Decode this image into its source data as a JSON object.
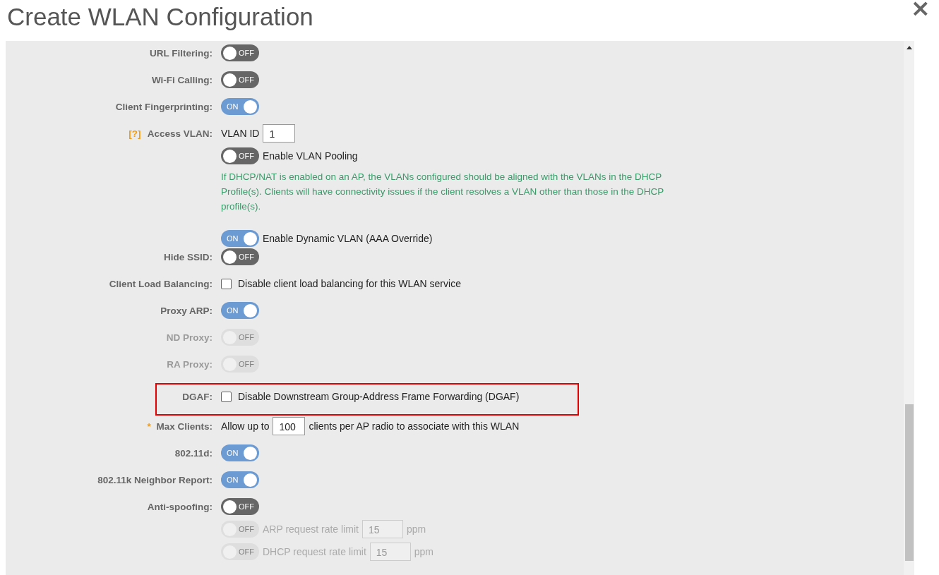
{
  "dialog": {
    "title": "Create WLAN Configuration",
    "close": "×"
  },
  "rows": [
    {
      "label": "URL Filtering:",
      "disabled": false,
      "highlighted": false,
      "lines": [
        [
          {
            "kind": "toggle",
            "on": false,
            "text": "OFF",
            "disabled": false
          }
        ]
      ]
    },
    {
      "label": "Wi-Fi Calling:",
      "disabled": false,
      "highlighted": false,
      "lines": [
        [
          {
            "kind": "toggle",
            "on": false,
            "text": "OFF",
            "disabled": false
          }
        ]
      ]
    },
    {
      "label": "Client Fingerprinting:",
      "disabled": false,
      "highlighted": false,
      "lines": [
        [
          {
            "kind": "toggle",
            "on": true,
            "text": "ON",
            "disabled": false
          }
        ]
      ]
    },
    {
      "help": "[?]",
      "label": "Access VLAN:",
      "disabled": false,
      "highlighted": false,
      "lines": [
        [
          {
            "kind": "text",
            "text": "VLAN ID",
            "disabled": false
          },
          {
            "kind": "field",
            "value": "1",
            "disabled": false
          }
        ],
        [
          {
            "kind": "toggle",
            "on": false,
            "text": "OFF",
            "disabled": false
          },
          {
            "kind": "text",
            "text": "Enable VLAN Pooling",
            "disabled": false
          }
        ],
        [
          {
            "kind": "note",
            "text": "If DHCP/NAT is enabled on an AP, the VLANs configured should be aligned with the VLANs in the DHCP Profile(s). Clients will have connectivity issues if the client resolves a VLAN other than those in the DHCP profile(s)."
          }
        ],
        [
          {
            "kind": "toggle",
            "on": true,
            "text": "ON",
            "disabled": false
          },
          {
            "kind": "text",
            "text": "Enable Dynamic VLAN (AAA Override)",
            "disabled": false
          }
        ]
      ]
    },
    {
      "label": "Hide SSID:",
      "disabled": false,
      "highlighted": false,
      "lines": [
        [
          {
            "kind": "toggle",
            "on": false,
            "text": "OFF",
            "disabled": false
          }
        ]
      ]
    },
    {
      "label": "Client Load Balancing:",
      "disabled": false,
      "highlighted": false,
      "lines": [
        [
          {
            "kind": "checkbox",
            "checked": false,
            "label": "Disable client load balancing for this WLAN service"
          }
        ]
      ]
    },
    {
      "label": "Proxy ARP:",
      "disabled": false,
      "highlighted": false,
      "lines": [
        [
          {
            "kind": "toggle",
            "on": true,
            "text": "ON",
            "disabled": false
          }
        ]
      ]
    },
    {
      "label": "ND Proxy:",
      "disabled": true,
      "highlighted": false,
      "lines": [
        [
          {
            "kind": "toggle",
            "on": false,
            "text": "OFF",
            "disabled": true
          }
        ]
      ]
    },
    {
      "label": "RA Proxy:",
      "disabled": true,
      "highlighted": false,
      "lines": [
        [
          {
            "kind": "toggle",
            "on": false,
            "text": "OFF",
            "disabled": true
          }
        ]
      ]
    },
    {
      "label": "DGAF:",
      "disabled": false,
      "highlighted": true,
      "lines": [
        [
          {
            "kind": "checkbox",
            "checked": false,
            "label": "Disable Downstream Group-Address Frame Forwarding (DGAF)"
          }
        ]
      ]
    },
    {
      "required": "*",
      "label": "Max Clients:",
      "disabled": false,
      "highlighted": false,
      "lines": [
        [
          {
            "kind": "text",
            "text": "Allow up to",
            "disabled": false
          },
          {
            "kind": "field",
            "value": "100",
            "disabled": false
          },
          {
            "kind": "text",
            "text": "clients per AP radio to associate with this WLAN",
            "disabled": false
          }
        ]
      ]
    },
    {
      "label": "802.11d:",
      "disabled": false,
      "highlighted": false,
      "lines": [
        [
          {
            "kind": "toggle",
            "on": true,
            "text": "ON",
            "disabled": false
          }
        ]
      ]
    },
    {
      "label": "802.11k Neighbor Report:",
      "disabled": false,
      "highlighted": false,
      "lines": [
        [
          {
            "kind": "toggle",
            "on": true,
            "text": "ON",
            "disabled": false
          }
        ]
      ]
    },
    {
      "label": "Anti-spoofing:",
      "disabled": false,
      "highlighted": false,
      "lines": [
        [
          {
            "kind": "toggle",
            "on": false,
            "text": "OFF",
            "disabled": false
          }
        ],
        [
          {
            "kind": "toggle",
            "on": false,
            "text": "OFF",
            "disabled": true
          },
          {
            "kind": "text",
            "text": "ARP request rate limit",
            "disabled": true
          },
          {
            "kind": "field",
            "value": "15",
            "disabled": true
          },
          {
            "kind": "text",
            "text": "ppm",
            "disabled": true
          }
        ],
        [
          {
            "kind": "toggle",
            "on": false,
            "text": "OFF",
            "disabled": true
          },
          {
            "kind": "text",
            "text": "DHCP request rate limit",
            "disabled": true
          },
          {
            "kind": "field",
            "value": "15",
            "disabled": true
          },
          {
            "kind": "text",
            "text": "ppm",
            "disabled": true
          }
        ]
      ]
    }
  ]
}
